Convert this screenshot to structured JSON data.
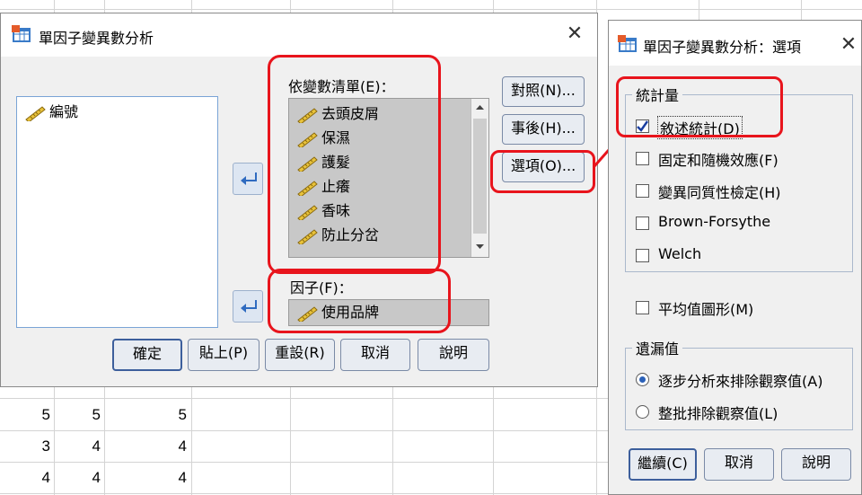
{
  "sheet": {
    "rows": [
      {
        "a": "5",
        "b": "5",
        "c": "5"
      },
      {
        "a": "3",
        "b": "4",
        "c": "4"
      },
      {
        "a": "4",
        "b": "4",
        "c": "4"
      }
    ]
  },
  "main_dialog": {
    "title": "單因子變異數分析",
    "close_glyph": "✕",
    "source_list": [
      "編號"
    ],
    "dependent_label": "依變數清單(E)：",
    "dependent_list": [
      "去頭皮屑",
      "保濕",
      "護髮",
      "止癢",
      "香味",
      "防止分岔"
    ],
    "factor_label": "因子(F)：",
    "factor_value": "使用品牌",
    "side_buttons": {
      "contrast": "對照(N)...",
      "posthoc": "事後(H)...",
      "options": "選項(O)..."
    },
    "bottom_buttons": {
      "ok": "確定",
      "paste": "貼上(P)",
      "reset": "重設(R)",
      "cancel": "取消",
      "help": "說明"
    }
  },
  "options_dialog": {
    "title": "單因子變異數分析：選項",
    "close_glyph": "✕",
    "statistics_group": "統計量",
    "statistics": [
      {
        "label": "敘述統計(D)",
        "checked": true
      },
      {
        "label": "固定和隨機效應(F)",
        "checked": false
      },
      {
        "label": "變異同質性檢定(H)",
        "checked": false
      },
      {
        "label": "Brown-Forsythe",
        "checked": false
      },
      {
        "label": "Welch",
        "checked": false
      }
    ],
    "means_plot": "平均值圖形(M)",
    "missing_group": "遺漏值",
    "missing_options": [
      {
        "label": "逐步分析來排除觀察值(A)",
        "selected": true
      },
      {
        "label": "整批排除觀察值(L)",
        "selected": false
      }
    ],
    "buttons": {
      "continue": "繼續(C)",
      "cancel": "取消",
      "help": "說明"
    }
  },
  "colors": {
    "highlight_red": "#e8141c",
    "focus_blue": "#3d5f9c",
    "list_border": "#7aa4d6"
  }
}
